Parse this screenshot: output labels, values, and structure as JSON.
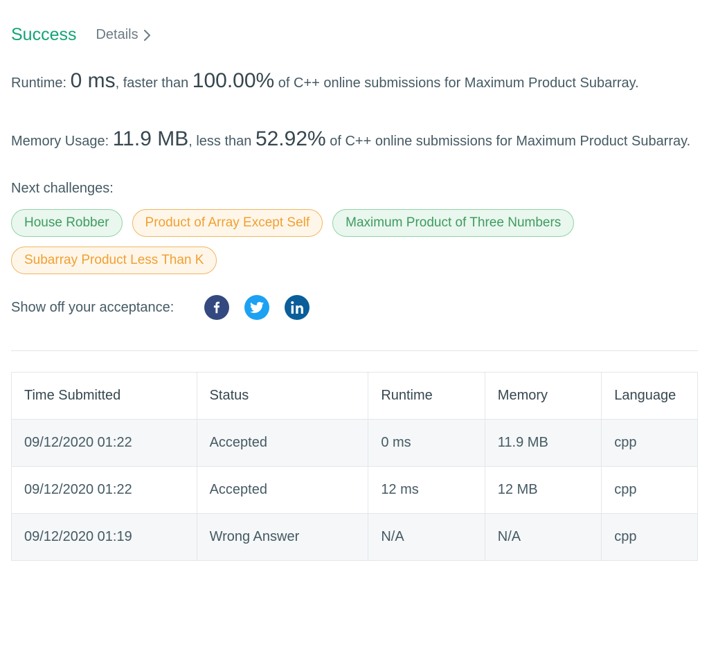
{
  "header": {
    "success_label": "Success",
    "details_label": "Details"
  },
  "runtime": {
    "prefix": "Runtime: ",
    "value": "0 ms",
    "mid": ", faster than ",
    "percent": "100.00%",
    "suffix": " of C++ online submissions for Maximum Product Subarray."
  },
  "memory": {
    "prefix": "Memory Usage: ",
    "value": "11.9 MB",
    "mid": ", less than ",
    "percent": "52.92%",
    "suffix": " of C++ online submissions for Maximum Product Subarray."
  },
  "next_label": "Next challenges:",
  "challenges": [
    {
      "label": "House Robber",
      "difficulty": "easy"
    },
    {
      "label": "Product of Array Except Self",
      "difficulty": "medium"
    },
    {
      "label": "Maximum Product of Three Numbers",
      "difficulty": "easy"
    },
    {
      "label": "Subarray Product Less Than K",
      "difficulty": "medium"
    }
  ],
  "share_label": "Show off your acceptance:",
  "table": {
    "headers": {
      "time": "Time Submitted",
      "status": "Status",
      "runtime": "Runtime",
      "memory": "Memory",
      "language": "Language"
    },
    "rows": [
      {
        "time": "09/12/2020 01:22",
        "status": "Accepted",
        "status_kind": "accepted",
        "runtime": "0 ms",
        "memory": "11.9 MB",
        "language": "cpp"
      },
      {
        "time": "09/12/2020 01:22",
        "status": "Accepted",
        "status_kind": "accepted",
        "runtime": "12 ms",
        "memory": "12 MB",
        "language": "cpp"
      },
      {
        "time": "09/12/2020 01:19",
        "status": "Wrong Answer",
        "status_kind": "wrong",
        "runtime": "N/A",
        "memory": "N/A",
        "language": "cpp"
      }
    ]
  }
}
